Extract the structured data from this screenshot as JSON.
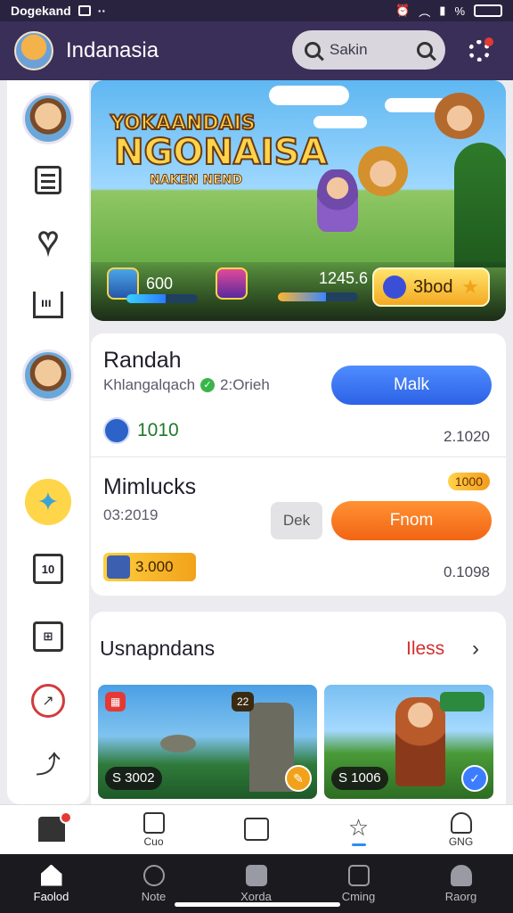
{
  "status_bar": {
    "carrier": "Dogekand",
    "right_text": "%"
  },
  "app": {
    "title": "Indanasia",
    "search_placeholder": "Sakin"
  },
  "hero": {
    "title_line1": "YOKAANDAIS",
    "title_line2": "NGONAISA",
    "title_line3": "NAKEN NEND",
    "stat_left": "600",
    "stat_mid": "1245.6",
    "button_label": "3bod",
    "progress_left": 0.55,
    "progress_mid": 0.6
  },
  "card": {
    "row1": {
      "title": "Randah",
      "subtitle": "Khlangalqach",
      "subtitle_extra": "2:Orieh",
      "button": "Malk",
      "coins": "1010",
      "right_value": "2.1020"
    },
    "row2": {
      "title": "Mimlucks",
      "subtitle": "03:2019",
      "badge": "1000",
      "secondary_button": "Dek",
      "button": "Fnom",
      "reward": "3.000",
      "right_value": "0.1098"
    }
  },
  "section": {
    "title": "Usnapndans",
    "badge": "Iless",
    "thumbs": [
      {
        "price": "S 3002",
        "tag": "22"
      },
      {
        "price": "S 1006",
        "tag": ""
      }
    ]
  },
  "tabbar_top": [
    {
      "label": "",
      "icon": "home-icon"
    },
    {
      "label": "Cuo",
      "icon": "square-icon"
    },
    {
      "label": "",
      "icon": "list-icon"
    },
    {
      "label": "",
      "icon": "star-icon"
    },
    {
      "label": "GNG",
      "icon": "bell-icon"
    }
  ],
  "tabbar_bottom": [
    {
      "label": "Faolod",
      "icon": "home-icon"
    },
    {
      "label": "Note",
      "icon": "chat-icon"
    },
    {
      "label": "Xorda",
      "icon": "bag-icon"
    },
    {
      "label": "Cming",
      "icon": "box-icon"
    },
    {
      "label": "Raorg",
      "icon": "user-icon"
    }
  ],
  "colors": {
    "appbar": "#3a2f58",
    "accent_blue": "#2c62e6",
    "accent_orange": "#f26414"
  }
}
